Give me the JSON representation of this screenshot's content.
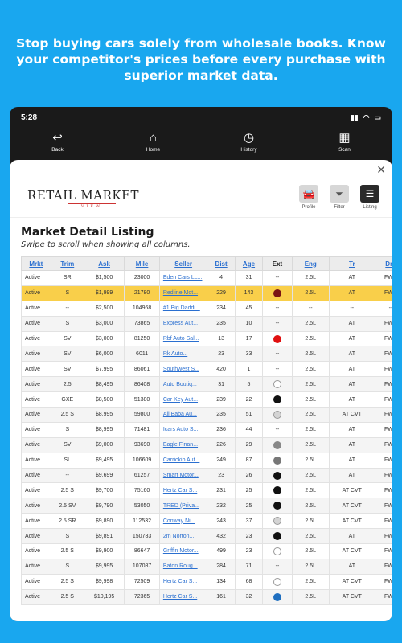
{
  "headline": "Stop buying cars solely from wholesale books. Know your competitor's prices before every purchase with superior market data.",
  "status": {
    "time": "5:28"
  },
  "nav": [
    {
      "label": "Back",
      "icon": "back-arrow-icon",
      "glyph": "↩"
    },
    {
      "label": "Home",
      "icon": "home-icon",
      "glyph": "⌂"
    },
    {
      "label": "History",
      "icon": "history-icon",
      "glyph": "◷"
    },
    {
      "label": "Scan",
      "icon": "scan-icon",
      "glyph": "▦"
    }
  ],
  "logo": {
    "main": "RETAIL MARKET",
    "sub": "VIEW"
  },
  "tools": [
    {
      "label": "Profile",
      "icon": "car-profile-icon",
      "glyph": "🚘"
    },
    {
      "label": "Filter",
      "icon": "filter-icon",
      "glyph": "⏷"
    },
    {
      "label": "Listing",
      "icon": "listing-icon",
      "glyph": "☰"
    }
  ],
  "title": "Market Detail Listing",
  "subtitle": "Swipe to scroll when showing all columns.",
  "columns": [
    "Mrkt",
    "Trim",
    "Ask",
    "Mile",
    "Seller",
    "Dist",
    "Age",
    "Ext",
    "Eng",
    "Tr",
    "Drv"
  ],
  "rows": [
    [
      "Active",
      "SR",
      "$1,500",
      "23000",
      "Eden Cars LL...",
      "4",
      "31",
      "--",
      "2.5L",
      "AT",
      "FWD"
    ],
    [
      "Active",
      "S",
      "$1,999",
      "21780",
      "Redline Mot...",
      "229",
      "143",
      "#7a1414",
      "2.5L",
      "AT",
      "FWD"
    ],
    [
      "Active",
      "--",
      "$2,500",
      "104968",
      "#1 Big Daddi...",
      "234",
      "45",
      "--",
      "--",
      "--",
      "--"
    ],
    [
      "Active",
      "S",
      "$3,000",
      "73865",
      "Express Aut...",
      "235",
      "10",
      "--",
      "2.5L",
      "AT",
      "FWD"
    ],
    [
      "Active",
      "SV",
      "$3,000",
      "81250",
      "Rbf Auto Sal...",
      "13",
      "17",
      "#e01010",
      "2.5L",
      "AT",
      "FWD"
    ],
    [
      "Active",
      "SV",
      "$6,000",
      "6011",
      "Rk Auto...",
      "23",
      "33",
      "--",
      "2.5L",
      "AT",
      "FWD"
    ],
    [
      "Active",
      "SV",
      "$7,995",
      "86061",
      "Southwest S...",
      "420",
      "1",
      "--",
      "2.5L",
      "AT",
      "FWD"
    ],
    [
      "Active",
      "2.5",
      "$8,495",
      "86408",
      "Auto Boutiq...",
      "31",
      "5",
      "#ffffff",
      "2.5L",
      "AT",
      "FWD"
    ],
    [
      "Active",
      "GXE",
      "$8,500",
      "51380",
      "Car Key Aut...",
      "239",
      "22",
      "#111111",
      "2.5L",
      "AT",
      "FWD"
    ],
    [
      "Active",
      "2.5 S",
      "$8,995",
      "59800",
      "Ali Baba Au...",
      "235",
      "51",
      "#d4d4d4",
      "2.5L",
      "AT CVT",
      "FWD"
    ],
    [
      "Active",
      "S",
      "$8,995",
      "71481",
      "Icars Auto S...",
      "236",
      "44",
      "--",
      "2.5L",
      "AT",
      "FWD"
    ],
    [
      "Active",
      "SV",
      "$9,000",
      "93690",
      "Eagle Finan...",
      "226",
      "29",
      "#888888",
      "2.5L",
      "AT",
      "FWD"
    ],
    [
      "Active",
      "SL",
      "$9,495",
      "106609",
      "Carrickio Aut...",
      "249",
      "87",
      "#777777",
      "2.5L",
      "AT",
      "FWD"
    ],
    [
      "Active",
      "--",
      "$9,699",
      "61257",
      "Smart Motor...",
      "23",
      "26",
      "#111111",
      "2.5L",
      "AT",
      "FWD"
    ],
    [
      "Active",
      "2.5 S",
      "$9,700",
      "75160",
      "Hertz Car S...",
      "231",
      "25",
      "#111111",
      "2.5L",
      "AT CVT",
      "FWD"
    ],
    [
      "Active",
      "2.5 SV",
      "$9,790",
      "53050",
      "TRED (Priva...",
      "232",
      "25",
      "#111111",
      "2.5L",
      "AT CVT",
      "FWD"
    ],
    [
      "Active",
      "2.5 SR",
      "$9,890",
      "112532",
      "Conway Ni...",
      "243",
      "37",
      "#d4d4d4",
      "2.5L",
      "AT CVT",
      "FWD"
    ],
    [
      "Active",
      "S",
      "$9,891",
      "150783",
      "2m Norton...",
      "432",
      "23",
      "#111111",
      "2.5L",
      "AT",
      "FWD"
    ],
    [
      "Active",
      "2.5 S",
      "$9,900",
      "86647",
      "Griffin Motor...",
      "499",
      "23",
      "#ffffff",
      "2.5L",
      "AT CVT",
      "FWD"
    ],
    [
      "Active",
      "S",
      "$9,995",
      "107087",
      "Baton Roug...",
      "284",
      "71",
      "--",
      "2.5L",
      "AT",
      "FWD"
    ],
    [
      "Active",
      "2.5 S",
      "$9,998",
      "72509",
      "Hertz Car S...",
      "134",
      "68",
      "#ffffff",
      "2.5L",
      "AT CVT",
      "FWD"
    ],
    [
      "Active",
      "2.5 S",
      "$10,195",
      "72365",
      "Hertz Car S...",
      "161",
      "32",
      "#1f6fc0",
      "2.5L",
      "AT CVT",
      "FWD"
    ]
  ],
  "highlight_row": 1
}
